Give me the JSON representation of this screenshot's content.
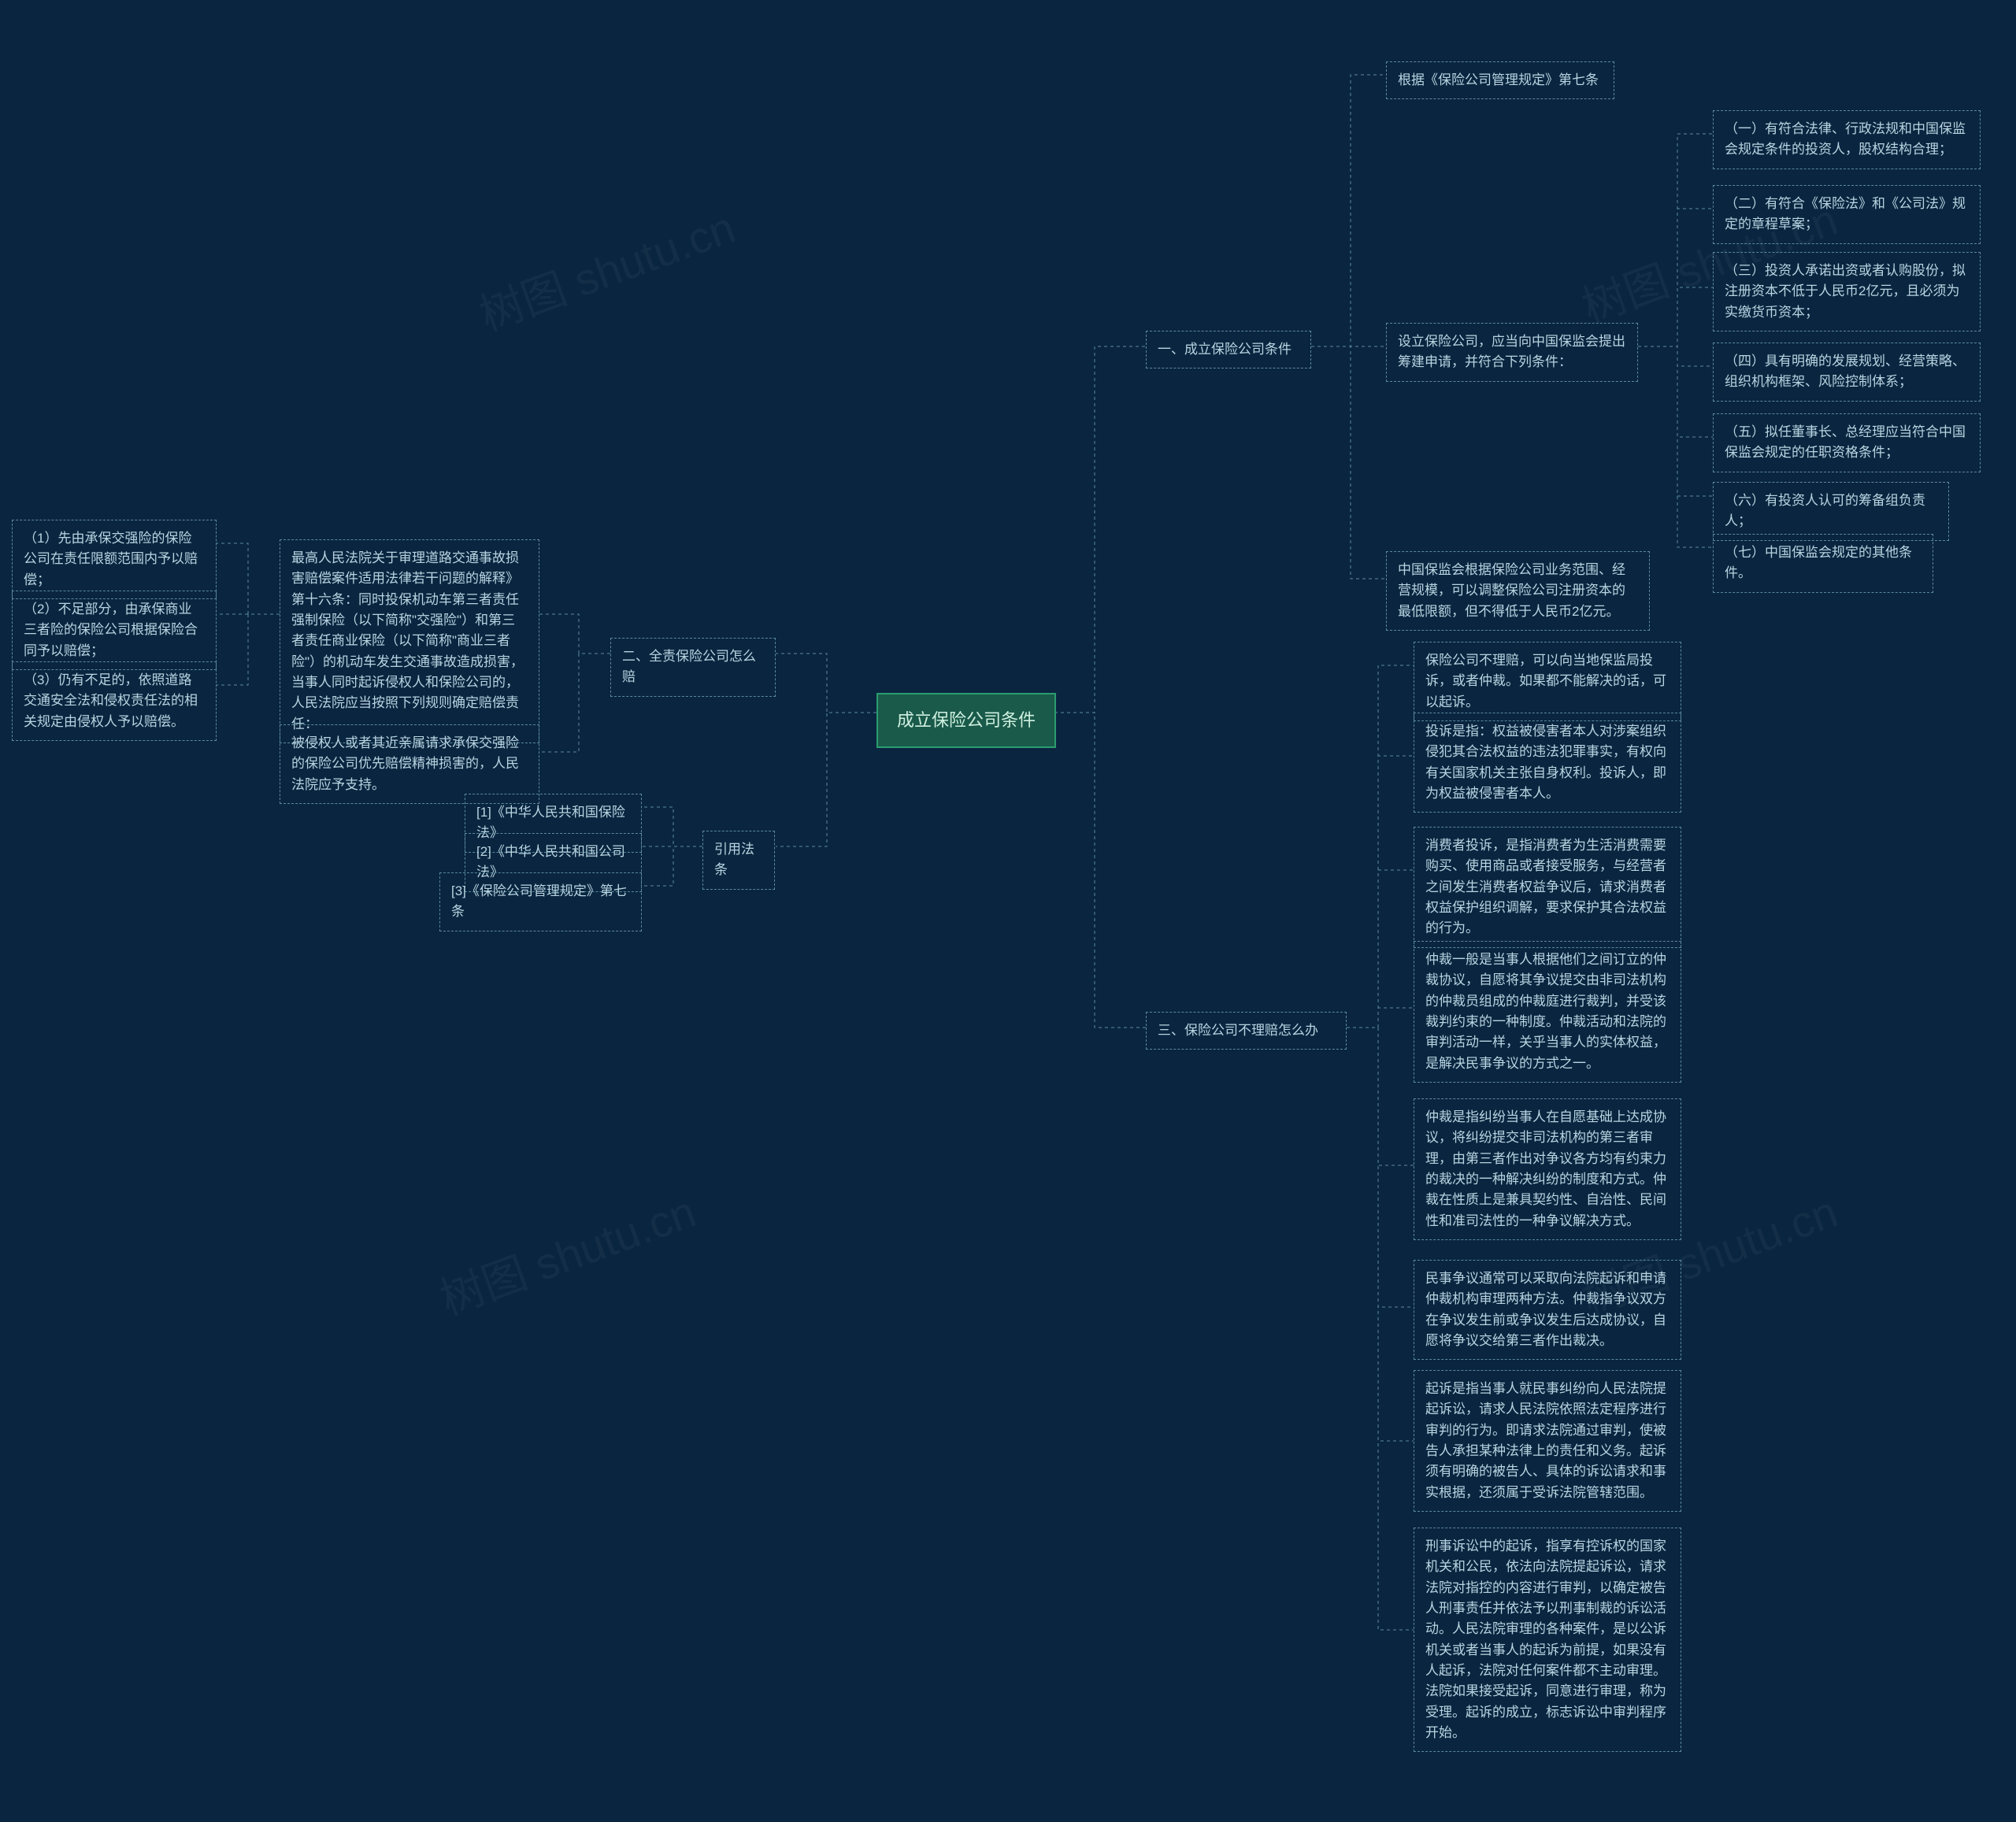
{
  "root": {
    "label": "成立保险公司条件"
  },
  "right": {
    "b1": {
      "label": "一、成立保险公司条件",
      "c1": "根据《保险公司管理规定》第七条",
      "c2": {
        "label": "设立保险公司，应当向中国保监会提出筹建申请，并符合下列条件：",
        "d1": "（一）有符合法律、行政法规和中国保监会规定条件的投资人，股权结构合理；",
        "d2": "（二）有符合《保险法》和《公司法》规定的章程草案；",
        "d3": "（三）投资人承诺出资或者认购股份，拟注册资本不低于人民币2亿元，且必须为实缴货币资本；",
        "d4": "（四）具有明确的发展规划、经营策略、组织机构框架、风险控制体系；",
        "d5": "（五）拟任董事长、总经理应当符合中国保监会规定的任职资格条件；",
        "d6": "（六）有投资人认可的筹备组负责人；",
        "d7": "（七）中国保监会规定的其他条件。"
      },
      "c3": "中国保监会根据保险公司业务范围、经营规模，可以调整保险公司注册资本的最低限额，但不得低于人民币2亿元。"
    },
    "b3": {
      "label": "三、保险公司不理赔怎么办",
      "c1": "保险公司不理赔，可以向当地保监局投诉，或者仲裁。如果都不能解决的话，可以起诉。",
      "c2": "投诉是指：权益被侵害者本人对涉案组织侵犯其合法权益的违法犯罪事实，有权向有关国家机关主张自身权利。投诉人，即为权益被侵害者本人。",
      "c3": "消费者投诉，是指消费者为生活消费需要购买、使用商品或者接受服务，与经营者之间发生消费者权益争议后，请求消费者权益保护组织调解，要求保护其合法权益的行为。",
      "c4": "仲裁一般是当事人根据他们之间订立的仲裁协议，自愿将其争议提交由非司法机构的仲裁员组成的仲裁庭进行裁判，并受该裁判约束的一种制度。仲裁活动和法院的审判活动一样，关乎当事人的实体权益，是解决民事争议的方式之一。",
      "c5": "仲裁是指纠纷当事人在自愿基础上达成协议，将纠纷提交非司法机构的第三者审理，由第三者作出对争议各方均有约束力的裁决的一种解决纠纷的制度和方式。仲裁在性质上是兼具契约性、自治性、民间性和准司法性的一种争议解决方式。",
      "c6": "民事争议通常可以采取向法院起诉和申请仲裁机构审理两种方法。仲裁指争议双方在争议发生前或争议发生后达成协议，自愿将争议交给第三者作出裁决。",
      "c7": "起诉是指当事人就民事纠纷向人民法院提起诉讼，请求人民法院依照法定程序进行审判的行为。即请求法院通过审判，使被告人承担某种法律上的责任和义务。起诉须有明确的被告人、具体的诉讼请求和事实根据，还须属于受诉法院管辖范围。",
      "c8": "刑事诉讼中的起诉，指享有控诉权的国家机关和公民，依法向法院提起诉讼，请求法院对指控的内容进行审判，以确定被告人刑事责任并依法予以刑事制裁的诉讼活动。人民法院审理的各种案件，是以公诉机关或者当事人的起诉为前提，如果没有人起诉，法院对任何案件都不主动审理。法院如果接受起诉，同意进行审理，称为受理。起诉的成立，标志诉讼中审判程序开始。"
    }
  },
  "left": {
    "b2": {
      "label": "二、全责保险公司怎么赔",
      "c1": {
        "label": "最高人民法院关于审理道路交通事故损害赔偿案件适用法律若干问题的解释》第十六条：同时投保机动车第三者责任强制保险（以下简称\"交强险\"）和第三者责任商业保险（以下简称\"商业三者险\"）的机动车发生交通事故造成损害，当事人同时起诉侵权人和保险公司的，人民法院应当按照下列规则确定赔偿责任：",
        "d1": "（1）先由承保交强险的保险公司在责任限额范围内予以赔偿；",
        "d2": "（2）不足部分，由承保商业三者险的保险公司根据保险合同予以赔偿；",
        "d3": "（3）仍有不足的，依照道路交通安全法和侵权责任法的相关规定由侵权人予以赔偿。"
      },
      "c2": "被侵权人或者其近亲属请求承保交强险的保险公司优先赔偿精神损害的，人民法院应予支持。"
    },
    "b4": {
      "label": "引用法条",
      "c1": "[1]《中华人民共和国保险法》",
      "c2": "[2]《中华人民共和国公司法》",
      "c3": "[3]《保险公司管理规定》第七条"
    }
  },
  "watermarks": [
    "树图 shutu.cn",
    "树图 shutu.cn",
    "树图 shutu.cn",
    "树图 shutu.cn"
  ]
}
